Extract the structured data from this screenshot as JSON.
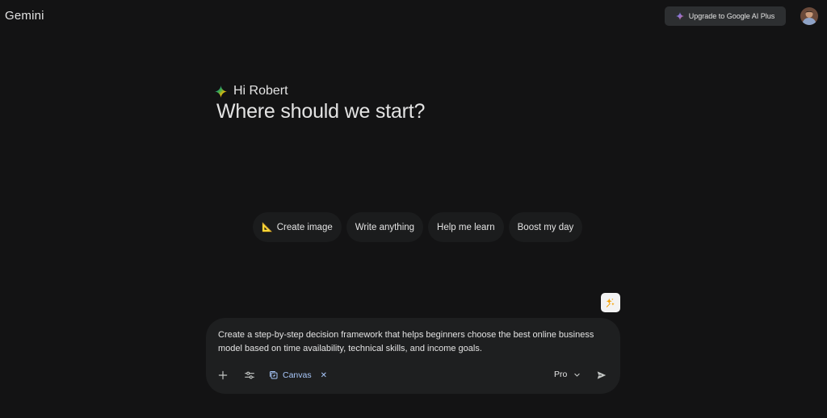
{
  "header": {
    "brand": "Gemini",
    "upgrade_label": "Upgrade to Google AI Plus"
  },
  "greeting": {
    "hello": "Hi Robert",
    "headline": "Where should we start?"
  },
  "chips": [
    {
      "emoji": "📐",
      "label": "Create image"
    },
    {
      "label": "Write anything"
    },
    {
      "label": "Help me learn"
    },
    {
      "label": "Boost my day"
    }
  ],
  "composer": {
    "prompt": "Create a step-by-step decision framework that helps beginners choose the best online business model based on time availability, technical skills, and income goals.",
    "tool_chip": "Canvas",
    "model": "Pro"
  },
  "colors": {
    "background": "#131314",
    "composer": "#1e1f20",
    "chip": "#1b1c1d",
    "accent_blue": "#a8c7fa"
  },
  "icons": {
    "brand_star": "gemini-sparkle-icon",
    "plus": "plus-icon",
    "tools": "tools-sliders-icon",
    "canvas": "canvas-icon",
    "close": "close-icon",
    "dropdown": "chevron-down-icon",
    "send": "send-icon",
    "prompt_enhance": "sparkle-wand-icon"
  }
}
